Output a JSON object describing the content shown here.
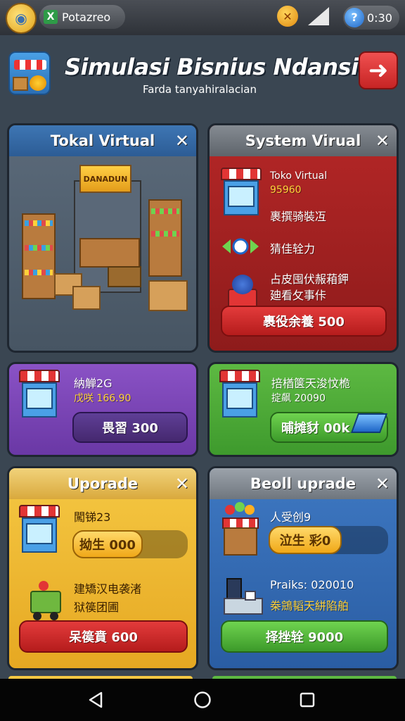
{
  "status": {
    "app_label": "Potazreo",
    "time": "0:30"
  },
  "header": {
    "title": "Simulasi Bisnius Ndansia",
    "subtitle": "Farda tanyahiralacian"
  },
  "panels": {
    "toko_virtual": {
      "title": "Tokal Virtual",
      "sign": "DANADUN"
    },
    "system_virtual": {
      "title": "System Virual",
      "line1": "Toko Virtual",
      "line2": "95960",
      "line3": "裹撰骑裝冱",
      "line4": "猜佳辁力",
      "line5": "占皮囤伏赧葙鉀",
      "line6": "廸看攵事佧",
      "button": "裹役余養 500"
    },
    "purple": {
      "line1": "納觯2G",
      "line2": "戊咲 166.90",
      "button": "畏習 300"
    },
    "green": {
      "line1": "掊楢箧天浚忟桅",
      "line2": "掟飙 20090",
      "button": "晡摊豺 00k"
    },
    "upgrade": {
      "title": "Uporade",
      "line1": "闖锑23",
      "bar_label": "拗生 000",
      "line2": "建矯汉电袭渚",
      "line3": "狱篌团圃",
      "button": "呆篌賁 600"
    },
    "beoll": {
      "title": "Beoll uprade",
      "line1": "人受创9",
      "bar_label": "泣生 彩0",
      "line2": "Praiks: 020010",
      "line3": "桊鵍韬天絣陷舶",
      "button": "择挫辁 9000"
    }
  },
  "colors": {
    "blue_header": "#3e76b4",
    "red_panel": "#b52727",
    "purple_panel": "#8a52c5",
    "green_panel": "#5db942",
    "gold_panel": "#f5c843",
    "blue_panel": "#3e78c2"
  },
  "icons": [
    "globe-icon",
    "spreadsheet-icon",
    "x-badge-icon",
    "signal-icon",
    "help-icon",
    "back-arrow-icon",
    "close-icon",
    "shop-icon",
    "cart-icon",
    "nav-back-icon",
    "nav-home-icon",
    "nav-recents-icon"
  ]
}
